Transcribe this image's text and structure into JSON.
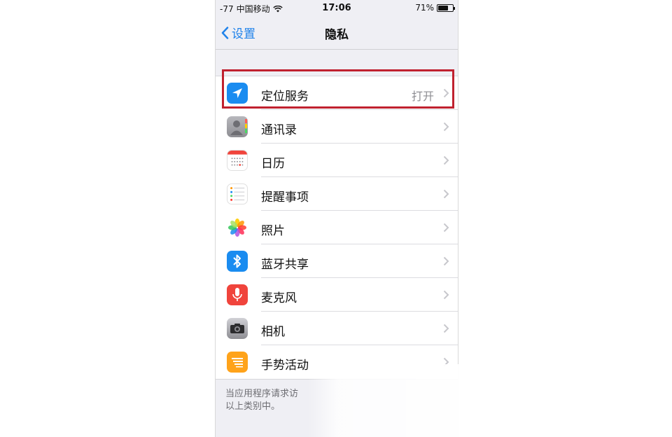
{
  "status_bar": {
    "signal": "-77",
    "carrier": "中国移动",
    "time": "17:06",
    "battery_percent": "71%",
    "battery_level": 0.71
  },
  "nav": {
    "back_label": "设置",
    "title": "隐私"
  },
  "rows": [
    {
      "label": "定位服务",
      "value": "打开",
      "icon": "location-arrow-icon"
    },
    {
      "label": "通讯录",
      "value": "",
      "icon": "contacts-icon"
    },
    {
      "label": "日历",
      "value": "",
      "icon": "calendar-icon"
    },
    {
      "label": "提醒事项",
      "value": "",
      "icon": "reminders-icon"
    },
    {
      "label": "照片",
      "value": "",
      "icon": "photos-icon"
    },
    {
      "label": "蓝牙共享",
      "value": "",
      "icon": "bluetooth-icon"
    },
    {
      "label": "麦克风",
      "value": "",
      "icon": "microphone-icon"
    },
    {
      "label": "相机",
      "value": "",
      "icon": "camera-icon"
    },
    {
      "label": "手势活动",
      "value": "",
      "icon": "motion-activity-icon"
    }
  ],
  "footer": {
    "line1": "当应用程序请求访",
    "line2": "以上类别中。"
  },
  "colors": {
    "accent": "#1f82ea",
    "highlight": "#c0212f"
  }
}
